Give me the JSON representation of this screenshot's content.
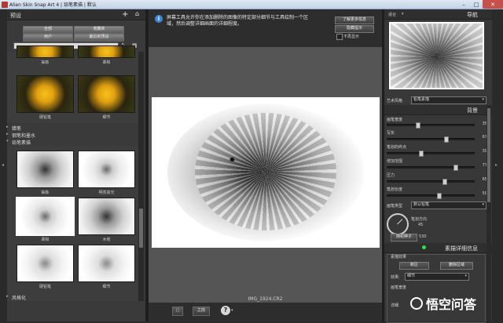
{
  "window": {
    "title": "Alien Skin Snap Art 4 | 铅笔素描 | 默认"
  },
  "left_panel": {
    "header": "预设",
    "tabs": [
      "全部",
      "收藏夹",
      "用户",
      "最近的预设"
    ],
    "top_thumbs": [
      {
        "label": "抽象"
      },
      {
        "label": "柔和"
      },
      {
        "label": "硬铅笔"
      },
      {
        "label": "细节"
      }
    ],
    "categories": [
      "蜡笔",
      "钢笔和墨水",
      "铅笔素描"
    ],
    "sketch_thumbs": [
      {
        "label": "抽象"
      },
      {
        "label": "明亮高光"
      },
      {
        "label": "柔和"
      },
      {
        "label": "木炭"
      },
      {
        "label": "硬铅笔"
      },
      {
        "label": "细节"
      }
    ],
    "bottom_category": "风格化"
  },
  "tip": {
    "text": "屏幕工具允许你在添加删除的图像的特定部分细节与工具绘制一个区域，然后调整详细画面的详细程度。",
    "learn_more": "了解更多信息",
    "hide": "隐藏提示",
    "dont_show": "不再显示"
  },
  "canvas": {
    "filename": "IMG_1924.CR2"
  },
  "bottom_bar": {
    "compare_label": "之前",
    "help_icon": "help-icon"
  },
  "right_panel": {
    "zoom_label": "适合",
    "navigator_title": "导航",
    "art_style_label": "艺术风格",
    "art_style_value": "铅笔素描",
    "background_title": "背景",
    "sliders": [
      {
        "label": "画笔宽度",
        "value": "35",
        "pos": 0.35
      },
      {
        "label": "写实",
        "value": "67",
        "pos": 0.67
      },
      {
        "label": "笔划的终点",
        "value": "39",
        "pos": 0.39
      },
      {
        "label": "增加范围",
        "value": "77",
        "pos": 0.77
      },
      {
        "label": "压力",
        "value": "65",
        "pos": 0.65
      },
      {
        "label": "笔划长度",
        "value": "59",
        "pos": 0.59
      }
    ],
    "brush_type_label": "画笔类型",
    "brush_type_value": "默认铅笔",
    "stroke_dir_label": "笔划方向",
    "stroke_dir_value": "45",
    "random_seed_label": "随机种子",
    "random_seed_value": "530",
    "detail_title": "素描详细信息",
    "detail_group_title": "素描效果",
    "add_btn": "新区",
    "remove_btn": "删除区域",
    "effect_label": "效果:",
    "effect_value": "细节",
    "brush_width_label": "画笔宽度",
    "detail_label": "详细"
  },
  "watermark": "悟空问答"
}
